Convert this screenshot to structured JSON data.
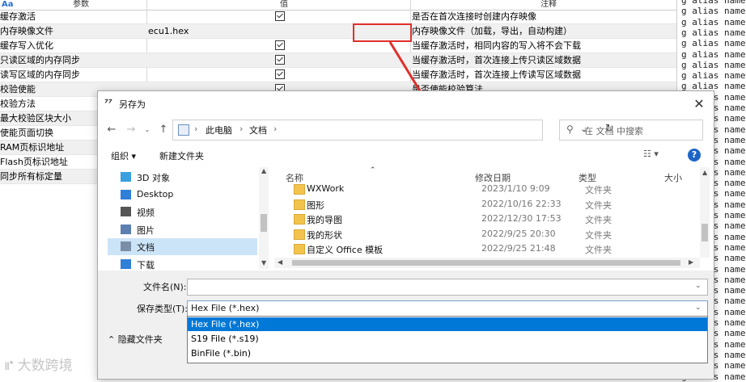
{
  "table": {
    "headers": {
      "name": "参数",
      "value": "值",
      "note": "注释"
    },
    "rows": [
      {
        "name": "缓存激活",
        "value": "",
        "checked": true,
        "note": "是否在首次连接时创建内存映像"
      },
      {
        "name": "内存映像文件",
        "value": "ecu1.hex",
        "checked": false,
        "note": "内存映像文件（加载，导出，自动构建）"
      },
      {
        "name": "缓存写入优化",
        "value": "",
        "checked": true,
        "note": "当缓存激活时，相同内容的写入将不会下载"
      },
      {
        "name": "只读区域的内存同步",
        "value": "",
        "checked": true,
        "note": "当缓存激活时，首次连接上传只读区域数据"
      },
      {
        "name": "读写区域的内存同步",
        "value": "",
        "checked": true,
        "note": "当缓存激活时，首次连接上传读写区域数据"
      },
      {
        "name": "校验使能",
        "value": "",
        "checked": true,
        "note": "是否使能校验算法"
      },
      {
        "name": "校验方法",
        "value": "",
        "checked": false,
        "note": ""
      },
      {
        "name": "最大校验区块大小",
        "value": "",
        "checked": false,
        "note": ""
      },
      {
        "name": "使能页面切换",
        "value": "",
        "checked": false,
        "note": ""
      },
      {
        "name": "RAM页标识地址",
        "value": "",
        "checked": false,
        "note": ""
      },
      {
        "name": "Flash页标识地址",
        "value": "",
        "checked": false,
        "note": ""
      },
      {
        "name": "同步所有标定量",
        "value": "",
        "checked": false,
        "note": ""
      }
    ]
  },
  "alias_panel": {
    "line_text": "g alias name:"
  },
  "dialog": {
    "title": "另存为",
    "close_glyph": "✕",
    "breadcrumb": [
      "此电脑",
      "文档"
    ],
    "search_placeholder": "在 文档 中搜索",
    "organize": "组织 ▾",
    "new_folder": "新建文件夹",
    "help": "?",
    "nav_items": [
      {
        "label": "3D 对象",
        "icon": "3d-objects-icon",
        "selected": false
      },
      {
        "label": "Desktop",
        "icon": "desktop-icon",
        "selected": false
      },
      {
        "label": "视频",
        "icon": "video-icon",
        "selected": false
      },
      {
        "label": "图片",
        "icon": "pictures-icon",
        "selected": false
      },
      {
        "label": "文档",
        "icon": "documents-icon",
        "selected": true
      },
      {
        "label": "下载",
        "icon": "download-icon",
        "selected": false
      }
    ],
    "columns": {
      "name": "名称",
      "date": "修改日期",
      "type": "类型",
      "size": "大小"
    },
    "files": [
      {
        "name": "WXWork",
        "date": "2023/1/10 9:09",
        "type": "文件夹"
      },
      {
        "name": "图形",
        "date": "2022/10/16 22:33",
        "type": "文件夹"
      },
      {
        "name": "我的导图",
        "date": "2022/12/30 17:53",
        "type": "文件夹"
      },
      {
        "name": "我的形状",
        "date": "2022/9/25 20:30",
        "type": "文件夹"
      },
      {
        "name": "自定义 Office 模板",
        "date": "2022/9/25 21:48",
        "type": "文件夹"
      }
    ],
    "filename_label": "文件名(N):",
    "filename_value": "",
    "filetype_label": "保存类型(T):",
    "filetype_selected": "Hex File (*.hex)",
    "filetype_options": [
      {
        "label": "Hex File (*.hex)",
        "selected": true
      },
      {
        "label": "S19 File (*.s19)",
        "selected": false
      },
      {
        "label": "BinFile (*.bin)",
        "selected": false
      }
    ],
    "hide_folders": "隐藏文件夹"
  },
  "watermark": "大数跨境",
  "colors": {
    "annotation_red": "#e0302b",
    "selection_blue": "#0078d7",
    "help_blue": "#1c65c8"
  }
}
